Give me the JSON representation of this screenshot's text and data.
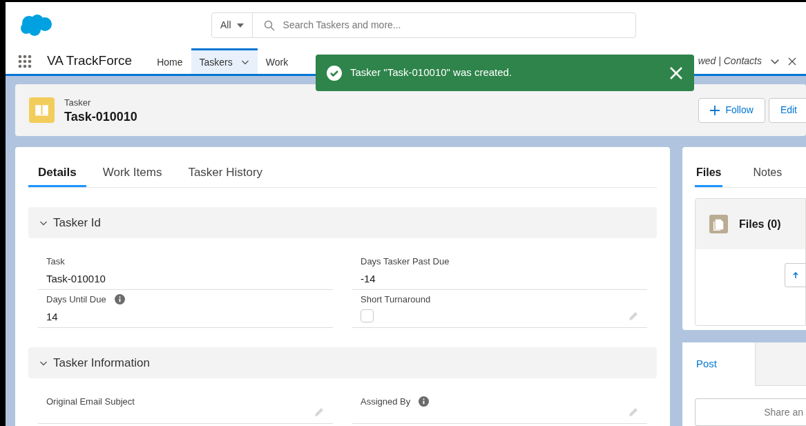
{
  "search": {
    "scope": "All",
    "placeholder": "Search Taskers and more..."
  },
  "app_name": "VA TrackForce",
  "nav_items": [
    {
      "label": "Home",
      "selected": false,
      "kind": "plain"
    },
    {
      "label": "Taskers",
      "selected": true,
      "kind": "dropdown"
    },
    {
      "label": "Work",
      "selected": false,
      "kind": "plain"
    }
  ],
  "open_tab": {
    "label": "wed | Contacts"
  },
  "toast": {
    "message": "Tasker \"Task-010010\" was created."
  },
  "record": {
    "type": "Tasker",
    "name": "Task-010010",
    "actions": [
      {
        "label": "Follow",
        "kind": "add"
      },
      {
        "label": "Edit",
        "kind": "plain"
      }
    ]
  },
  "tabs": [
    {
      "label": "Details",
      "selected": true
    },
    {
      "label": "Work Items",
      "selected": false
    },
    {
      "label": "Tasker History",
      "selected": false
    }
  ],
  "sections": [
    {
      "title": "Tasker Id",
      "expanded": true,
      "fields": [
        {
          "label": "Task",
          "value": "Task-010010",
          "kind": "text",
          "info": false,
          "editable": false
        },
        {
          "label": "Days Tasker Past Due",
          "value": "-14",
          "kind": "text",
          "info": false,
          "editable": false
        },
        {
          "label": "Days Until Due",
          "value": "14",
          "kind": "text",
          "info": true,
          "editable": false
        },
        {
          "label": "Short Turnaround",
          "kind": "checkbox",
          "checked": false,
          "info": false,
          "editable": true
        }
      ]
    },
    {
      "title": "Tasker Information",
      "expanded": true,
      "fields": [
        {
          "label": "Original Email Subject",
          "kind": "text",
          "info": false,
          "editable": true
        },
        {
          "label": "Assigned By",
          "kind": "text",
          "info": true,
          "editable": true
        }
      ]
    }
  ],
  "side_tabs": [
    {
      "label": "Files",
      "selected": true
    },
    {
      "label": "Notes",
      "selected": false
    }
  ],
  "files": {
    "title": "Files (0)"
  },
  "feed": {
    "tabs": [
      {
        "label": "Post",
        "selected": true
      }
    ],
    "placeholder": "Share an"
  }
}
